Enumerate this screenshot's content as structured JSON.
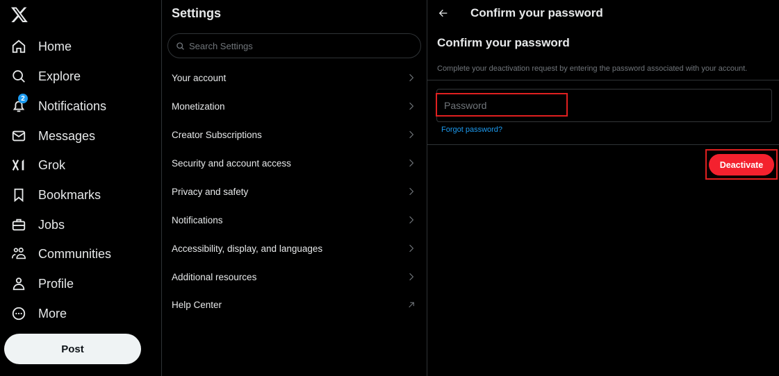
{
  "sidebar": {
    "logo": "x-logo",
    "items": [
      {
        "label": "Home",
        "icon": "home-icon"
      },
      {
        "label": "Explore",
        "icon": "search-icon"
      },
      {
        "label": "Notifications",
        "icon": "bell-icon",
        "badge": "2"
      },
      {
        "label": "Messages",
        "icon": "envelope-icon"
      },
      {
        "label": "Grok",
        "icon": "grok-icon"
      },
      {
        "label": "Bookmarks",
        "icon": "bookmark-icon"
      },
      {
        "label": "Jobs",
        "icon": "briefcase-icon"
      },
      {
        "label": "Communities",
        "icon": "people-icon"
      },
      {
        "label": "Profile",
        "icon": "person-icon"
      },
      {
        "label": "More",
        "icon": "more-circle-icon"
      }
    ],
    "post_label": "Post"
  },
  "settings": {
    "title": "Settings",
    "search_placeholder": "Search Settings",
    "items": [
      {
        "label": "Your account",
        "icon": "chevron-right-icon"
      },
      {
        "label": "Monetization",
        "icon": "chevron-right-icon"
      },
      {
        "label": "Creator Subscriptions",
        "icon": "chevron-right-icon"
      },
      {
        "label": "Security and account access",
        "icon": "chevron-right-icon"
      },
      {
        "label": "Privacy and safety",
        "icon": "chevron-right-icon"
      },
      {
        "label": "Notifications",
        "icon": "chevron-right-icon"
      },
      {
        "label": "Accessibility, display, and languages",
        "icon": "chevron-right-icon"
      },
      {
        "label": "Additional resources",
        "icon": "chevron-right-icon"
      },
      {
        "label": "Help Center",
        "icon": "external-arrow-icon"
      }
    ]
  },
  "confirm": {
    "header": "Confirm your password",
    "title": "Confirm your password",
    "description": "Complete your deactivation request by entering the password associated with your account.",
    "password_placeholder": "Password",
    "password_value": "",
    "forgot_label": "Forgot password?",
    "deactivate_label": "Deactivate"
  },
  "colors": {
    "background": "#000000",
    "text": "#e7e9ea",
    "muted": "#71767b",
    "accent": "#1d9bf0",
    "danger": "#f4212e",
    "highlight": "#e02020"
  }
}
